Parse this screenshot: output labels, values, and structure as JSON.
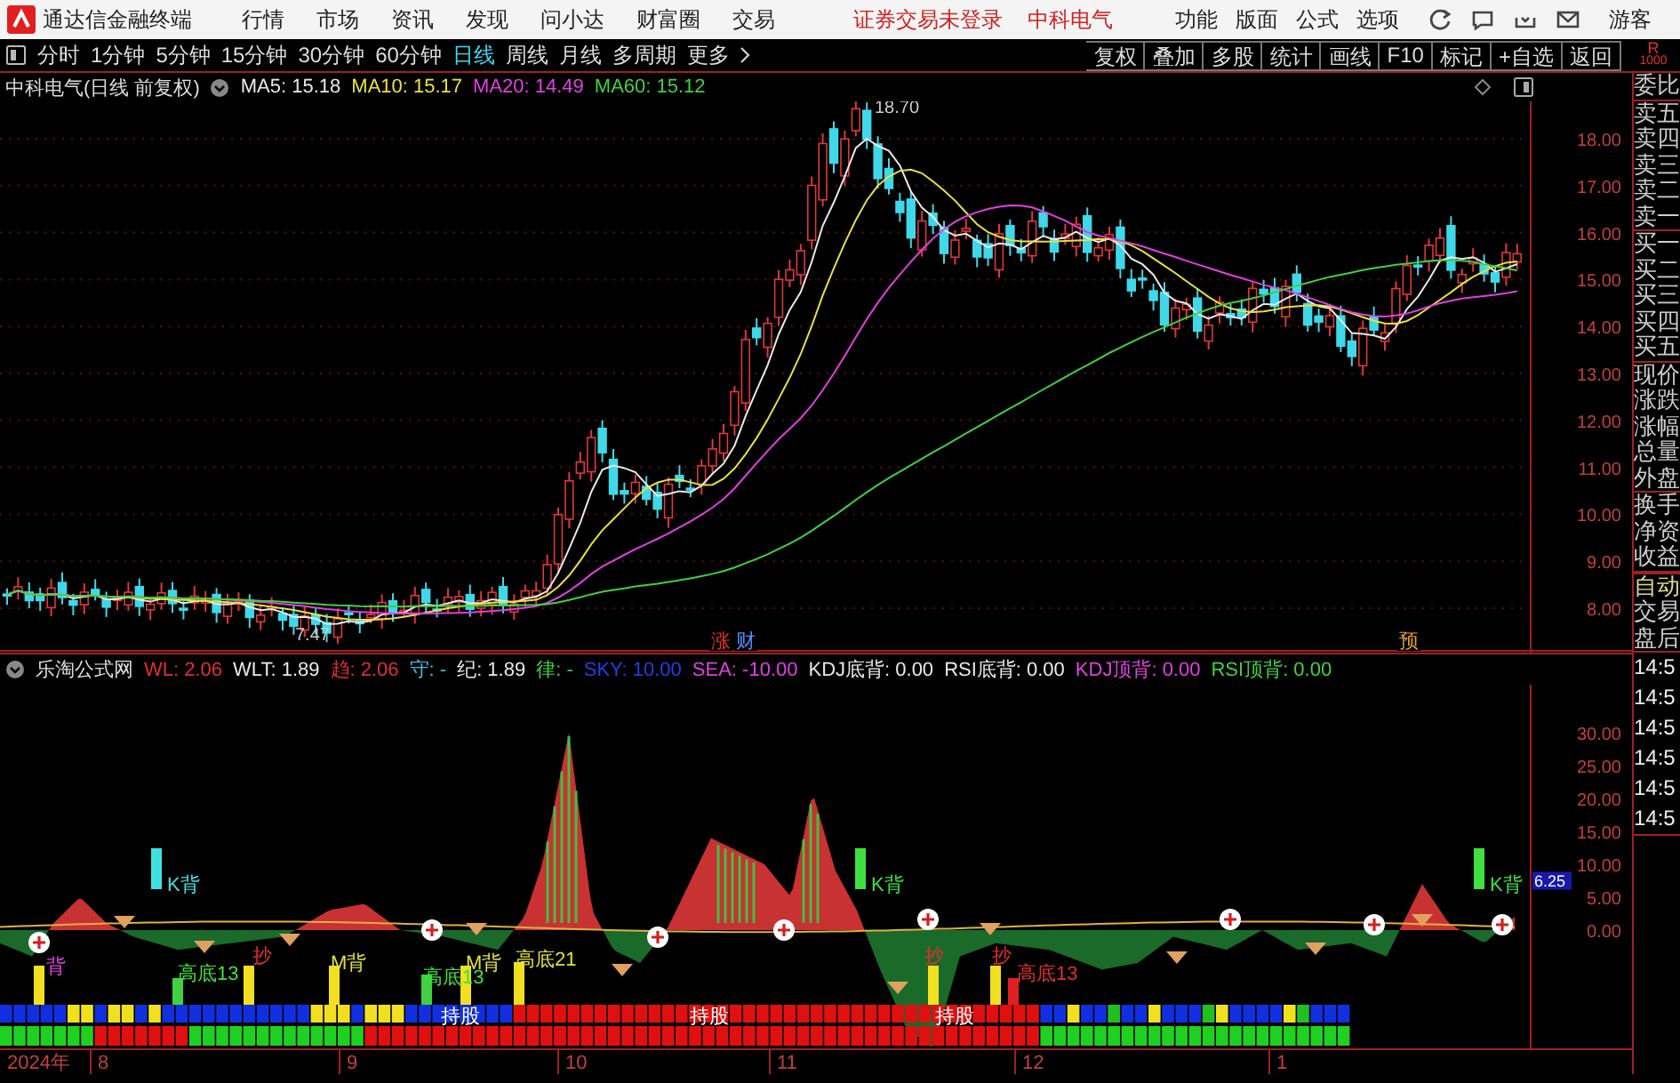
{
  "app": {
    "title": "通达信金融终端",
    "menu": [
      "行情",
      "市场",
      "资讯",
      "发现",
      "问小达",
      "财富圈",
      "交易"
    ],
    "login_status": "证券交易未登录",
    "stock_name": "中科电气",
    "right_menu": [
      "功能",
      "版面",
      "公式",
      "选项"
    ],
    "user": "游客"
  },
  "periods": [
    {
      "label": "分时",
      "selected": false
    },
    {
      "label": "1分钟",
      "selected": false
    },
    {
      "label": "5分钟",
      "selected": false
    },
    {
      "label": "15分钟",
      "selected": false
    },
    {
      "label": "30分钟",
      "selected": false
    },
    {
      "label": "60分钟",
      "selected": false
    },
    {
      "label": "日线",
      "selected": true
    },
    {
      "label": "周线",
      "selected": false
    },
    {
      "label": "月线",
      "selected": false
    },
    {
      "label": "多周期",
      "selected": false
    },
    {
      "label": "更多",
      "selected": false
    }
  ],
  "tools": [
    "复权",
    "叠加",
    "多股",
    "统计",
    "画线",
    "F10",
    "标记",
    "+自选",
    "返回"
  ],
  "price_chart": {
    "title": "中科电气(日线 前复权)",
    "ma": [
      {
        "label": "MA5: 15.18",
        "color": "#e8e8e8"
      },
      {
        "label": "MA10: 15.17",
        "color": "#e8e040"
      },
      {
        "label": "MA20: 14.49",
        "color": "#e040e0"
      },
      {
        "label": "MA60: 15.12",
        "color": "#40d040"
      }
    ],
    "high_label": "18.70",
    "low_label": "7.47",
    "events": [
      {
        "text": "涨",
        "color": "#e03030"
      },
      {
        "text": "财",
        "color": "#5090ff"
      },
      {
        "text": "预",
        "color": "#e0a030"
      }
    ],
    "y_axis": [
      "18.00",
      "17.00",
      "16.00",
      "15.00",
      "14.00",
      "13.00",
      "12.00",
      "11.00",
      "10.00",
      "9.00",
      "8.00"
    ],
    "corner": [
      "R",
      "1000"
    ]
  },
  "indicator": {
    "name": "乐淘公式网",
    "values": [
      {
        "text": "WL: 2.06",
        "color": "#e03030"
      },
      {
        "text": "WLT: 1.89",
        "color": "#e8e8e8"
      },
      {
        "text": "趋: 2.06",
        "color": "#e03030"
      },
      {
        "text": "守: -",
        "color": "#40c0e0"
      },
      {
        "text": "纪: 1.89",
        "color": "#e8e8e8"
      },
      {
        "text": "律: -",
        "color": "#40d040"
      },
      {
        "text": "SKY: 10.00",
        "color": "#2040e0"
      },
      {
        "text": "SEA: -10.00",
        "color": "#e040e0"
      },
      {
        "text": "KDJ底背: 0.00",
        "color": "#e8e8e8"
      },
      {
        "text": "RSI底背: 0.00",
        "color": "#e8e8e8"
      },
      {
        "text": "KDJ顶背: 0.00",
        "color": "#e040e0"
      },
      {
        "text": "RSI顶背: 0.00",
        "color": "#40d040"
      }
    ],
    "labels": [
      {
        "text": "K背",
        "color": "#40e0e0"
      },
      {
        "text": "背",
        "color": "#e040e0"
      },
      {
        "text": "高底13",
        "color": "#40e040"
      },
      {
        "text": "抄",
        "color": "#e03030"
      },
      {
        "text": "M背",
        "color": "#e0e040"
      },
      {
        "text": "高底13",
        "color": "#40e040"
      },
      {
        "text": "M背",
        "color": "#e0e040"
      },
      {
        "text": "高底21",
        "color": "#e0e040"
      },
      {
        "text": "抄",
        "color": "#e03030"
      },
      {
        "text": "抄",
        "color": "#e03030"
      },
      {
        "text": "高底13",
        "color": "#e03030"
      },
      {
        "text": "K背",
        "color": "#40e040"
      },
      {
        "text": "K背",
        "color": "#40e040"
      },
      {
        "text": "持股",
        "color": "#ffffff"
      },
      {
        "text": "持股",
        "color": "#ffffff"
      },
      {
        "text": "持股",
        "color": "#ffffff"
      }
    ],
    "y_axis": [
      "30.00",
      "25.00",
      "20.00",
      "15.00",
      "10.00",
      "5.00",
      "0.00"
    ],
    "badge": "6.25"
  },
  "dates": [
    "2024年",
    "8",
    "9",
    "10",
    "11",
    "12",
    "1"
  ],
  "quote_panel": [
    [
      "委比"
    ],
    [
      "卖五",
      "卖四",
      "卖三",
      "卖二",
      "卖一"
    ],
    [
      "买一",
      "买二",
      "买三",
      "买四",
      "买五"
    ],
    [
      "现价",
      "涨跌",
      "涨幅",
      "总量",
      "外盘"
    ],
    [
      "换手",
      "净资",
      "收益"
    ]
  ],
  "trade_panel": {
    "modes": [
      "自动",
      "交易",
      "盘后"
    ],
    "times": [
      "14:5",
      "14:5",
      "14:5",
      "14:5",
      "14:5",
      "14:5"
    ]
  }
}
